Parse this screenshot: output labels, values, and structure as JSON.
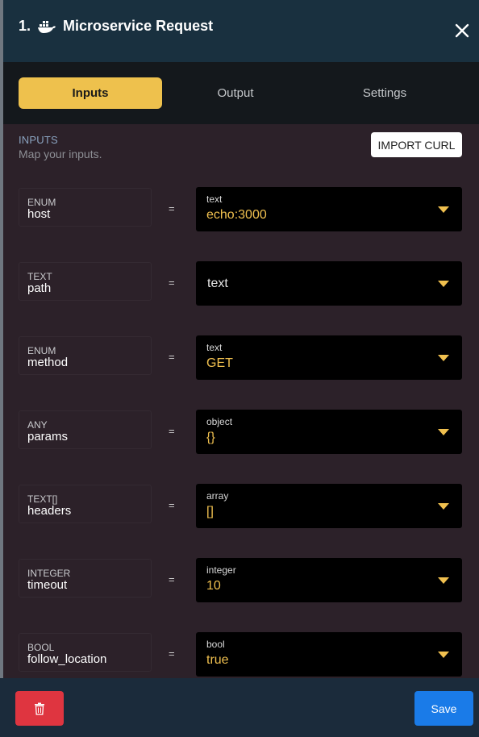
{
  "header": {
    "step": "1.",
    "title": "Microservice Request",
    "icon": "docker-icon"
  },
  "tabs": [
    {
      "label": "Inputs",
      "active": true
    },
    {
      "label": "Output",
      "active": false
    },
    {
      "label": "Settings",
      "active": false
    }
  ],
  "inputs_section": {
    "title": "INPUTS",
    "subtitle": "Map your inputs.",
    "import_label": "IMPORT CURL"
  },
  "rows": [
    {
      "type": "ENUM",
      "name": "host",
      "value_type": "text",
      "value": "echo:3000"
    },
    {
      "type": "TEXT",
      "name": "path",
      "value_type": "",
      "value": "",
      "placeholder": "text"
    },
    {
      "type": "ENUM",
      "name": "method",
      "value_type": "text",
      "value": "GET"
    },
    {
      "type": "ANY",
      "name": "params",
      "value_type": "object",
      "value": "{}"
    },
    {
      "type": "TEXT[]",
      "name": "headers",
      "value_type": "array",
      "value": "[]"
    },
    {
      "type": "INTEGER",
      "name": "timeout",
      "value_type": "integer",
      "value": "10"
    },
    {
      "type": "BOOL",
      "name": "follow_location",
      "value_type": "bool",
      "value": "true"
    }
  ],
  "eq_symbol": "=",
  "footer": {
    "save_label": "Save"
  },
  "colors": {
    "accent": "#eec14d",
    "value": "#f0c04f",
    "delete": "#df3540",
    "save": "#1a7be8"
  }
}
